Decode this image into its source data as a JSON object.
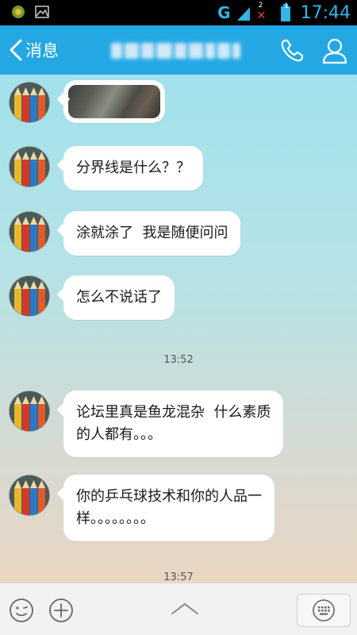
{
  "status_bar": {
    "network": "G",
    "sim1": "1",
    "sim2": "2",
    "time": "17:44"
  },
  "header": {
    "back_label": "消息",
    "icons": [
      "chevron-left-icon",
      "phone-icon",
      "profile-icon"
    ]
  },
  "messages": [
    {
      "type": "image"
    },
    {
      "type": "text",
      "lines": [
        "分界线是什么？？"
      ]
    },
    {
      "type": "text",
      "lines": [
        "涂就涂了  我是随便问问"
      ]
    },
    {
      "type": "text",
      "lines": [
        "怎么不说话了"
      ]
    },
    {
      "type": "time",
      "text": "13:52"
    },
    {
      "type": "text",
      "lines": [
        "论坛里真是鱼龙混杂  什么素质",
        "的人都有。。。"
      ]
    },
    {
      "type": "text",
      "lines": [
        "你的乒乓球技术和你的人品一",
        "样。。。。。。。。"
      ]
    },
    {
      "type": "time",
      "text": "13:57"
    }
  ],
  "toolbar": {
    "icons": [
      "emoji-icon",
      "plus-icon",
      "chevron-up-icon",
      "keyboard-icon"
    ]
  },
  "colors": {
    "header": "#24a8e3",
    "status_accent": "#33b5e5"
  }
}
